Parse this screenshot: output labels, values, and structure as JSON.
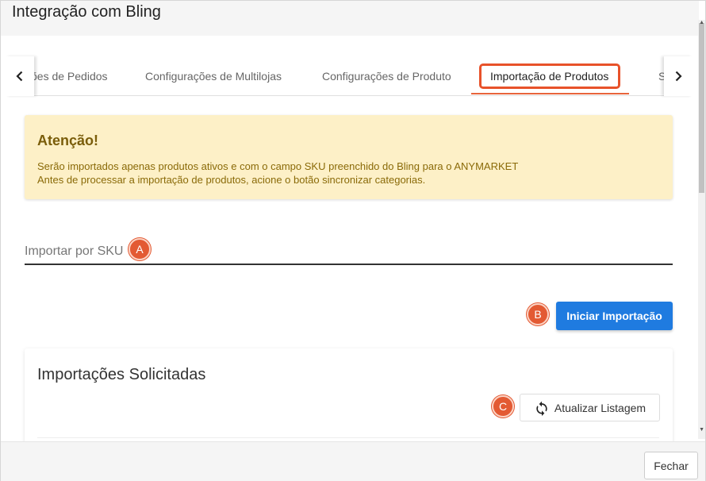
{
  "dialog": {
    "title": "Integração com Bling"
  },
  "tabs": {
    "items": [
      {
        "label": "ões de Pedidos"
      },
      {
        "label": "Configurações de Multilojas"
      },
      {
        "label": "Configurações de Produto"
      },
      {
        "label": "Importação de Produtos",
        "active": true
      },
      {
        "label": "S"
      }
    ],
    "left_arrow_icon": "chevron-left-icon",
    "right_arrow_icon": "chevron-right-icon"
  },
  "alert": {
    "title": "Atenção!",
    "line1": "Serão importados apenas produtos ativos e com o campo SKU preenchido do Bling para o ANYMARKET",
    "line2": "Antes de processar a importação de produtos, acione o botão sincronizar categorias."
  },
  "sku": {
    "placeholder": "Importar por SKU",
    "value": ""
  },
  "actions": {
    "start_import_label": "Iniciar Importação"
  },
  "requests": {
    "title": "Importações Solicitadas",
    "refresh_label": "Atualizar Listagem",
    "refresh_icon": "refresh-icon"
  },
  "markers": {
    "a": "A",
    "b": "B",
    "c": "C"
  },
  "footer": {
    "close_label": "Fechar"
  },
  "colors": {
    "accent": "#1f7be0",
    "marker": "#e35a33",
    "highlight": "#e8522a",
    "alert_bg": "#fdf0c7",
    "alert_text": "#8a6a08"
  }
}
